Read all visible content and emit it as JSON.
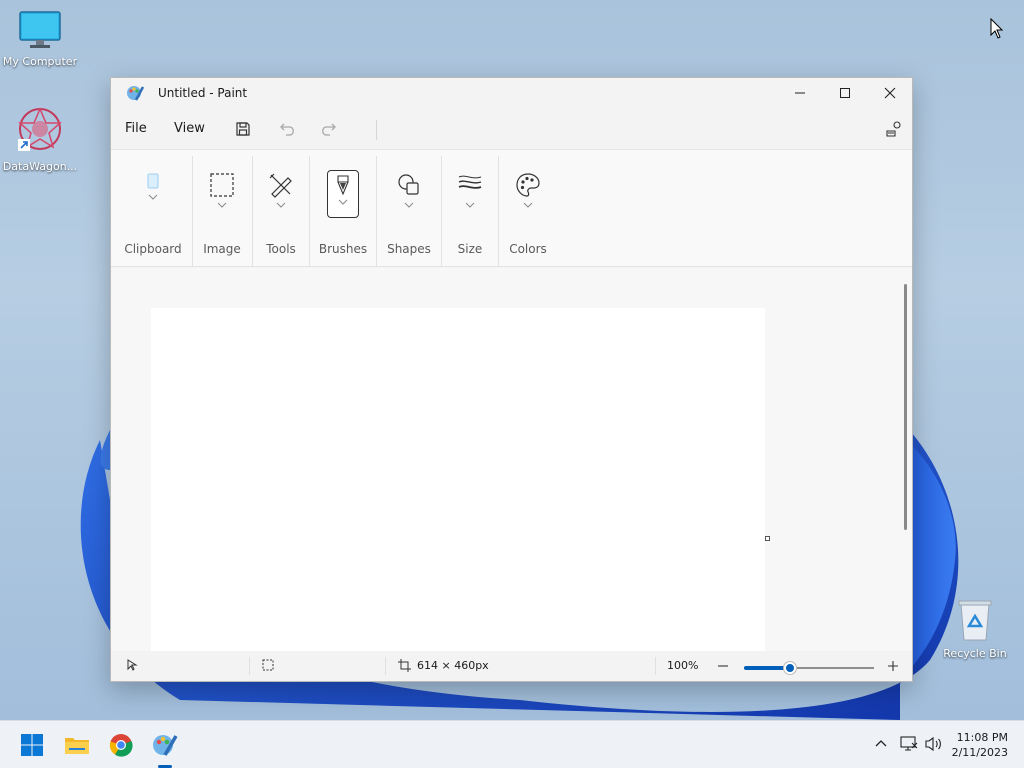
{
  "desktop": {
    "icons": [
      {
        "label": "My Computer"
      },
      {
        "label": "DataWagon..."
      },
      {
        "label": "Recycle Bin"
      }
    ]
  },
  "window": {
    "title": "Untitled - Paint",
    "menu": {
      "file": "File",
      "view": "View"
    },
    "ribbon": {
      "groups": [
        {
          "label": "Clipboard",
          "icon": "clipboard-icon"
        },
        {
          "label": "Image",
          "icon": "selection-icon"
        },
        {
          "label": "Tools",
          "icon": "tools-icon"
        },
        {
          "label": "Brushes",
          "icon": "brush-icon"
        },
        {
          "label": "Shapes",
          "icon": "shapes-icon"
        },
        {
          "label": "Size",
          "icon": "size-icon"
        },
        {
          "label": "Colors",
          "icon": "palette-icon"
        }
      ]
    },
    "status": {
      "canvas_size": "614 × 460px",
      "zoom": "100%",
      "zoom_fraction": 0.35
    }
  },
  "taskbar": {
    "time": "11:08 PM",
    "date": "2/11/2023"
  },
  "colors": {
    "accent": "#005fb8",
    "window_bg": "#f3f3f3",
    "ribbon_bg": "#f9f9f9"
  }
}
